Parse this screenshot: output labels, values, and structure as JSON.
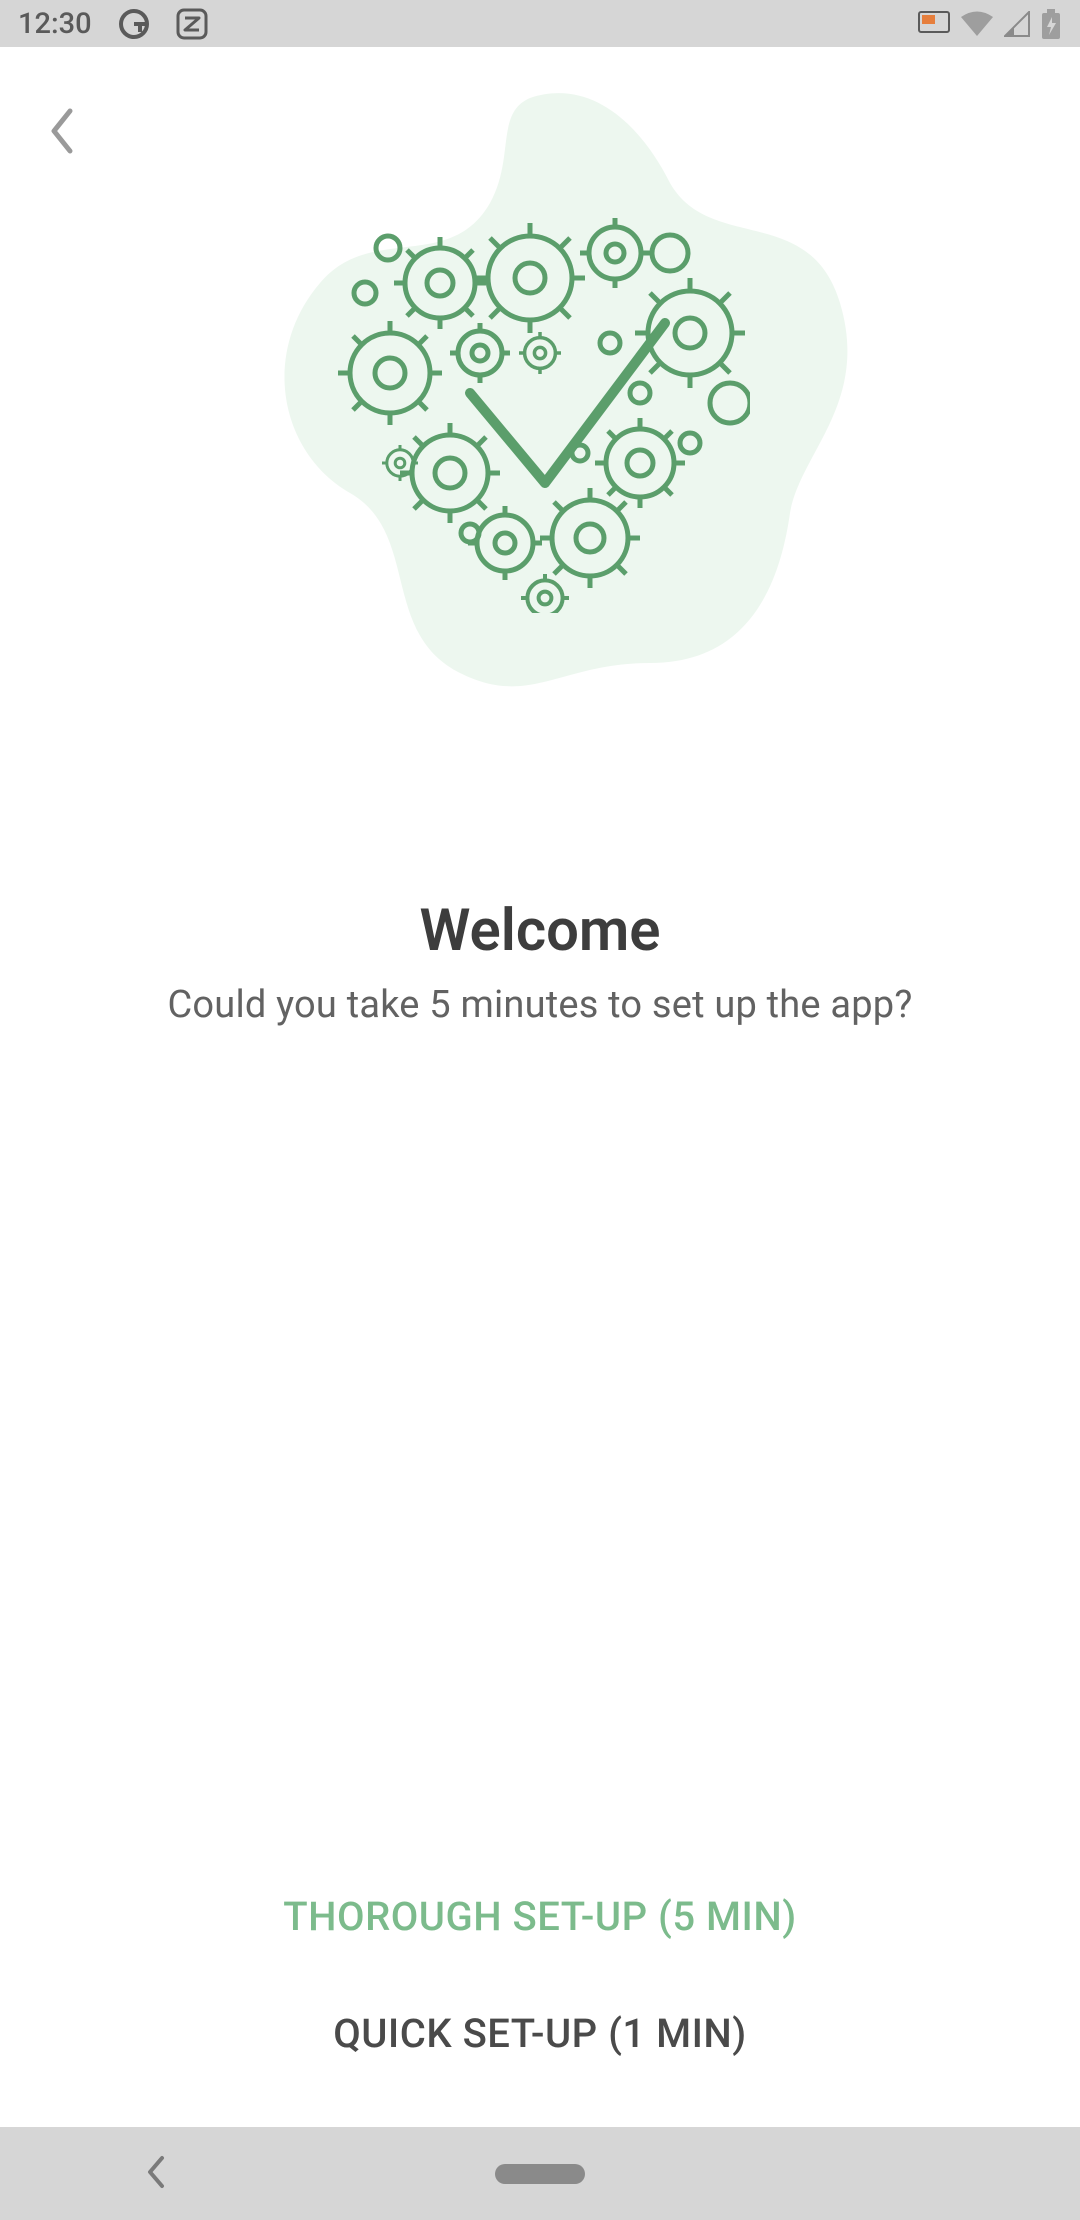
{
  "statusBar": {
    "time": "12:30"
  },
  "welcome": {
    "title": "Welcome",
    "subtitle": "Could you take 5 minutes to set up the app?"
  },
  "buttons": {
    "thorough": "THOROUGH SET-UP (5 MIN)",
    "quick": "QUICK SET-UP (1 MIN)"
  },
  "colors": {
    "accent": "#7cbb8c",
    "blob": "#edf7ef",
    "gearStroke": "#5b9e6b"
  }
}
